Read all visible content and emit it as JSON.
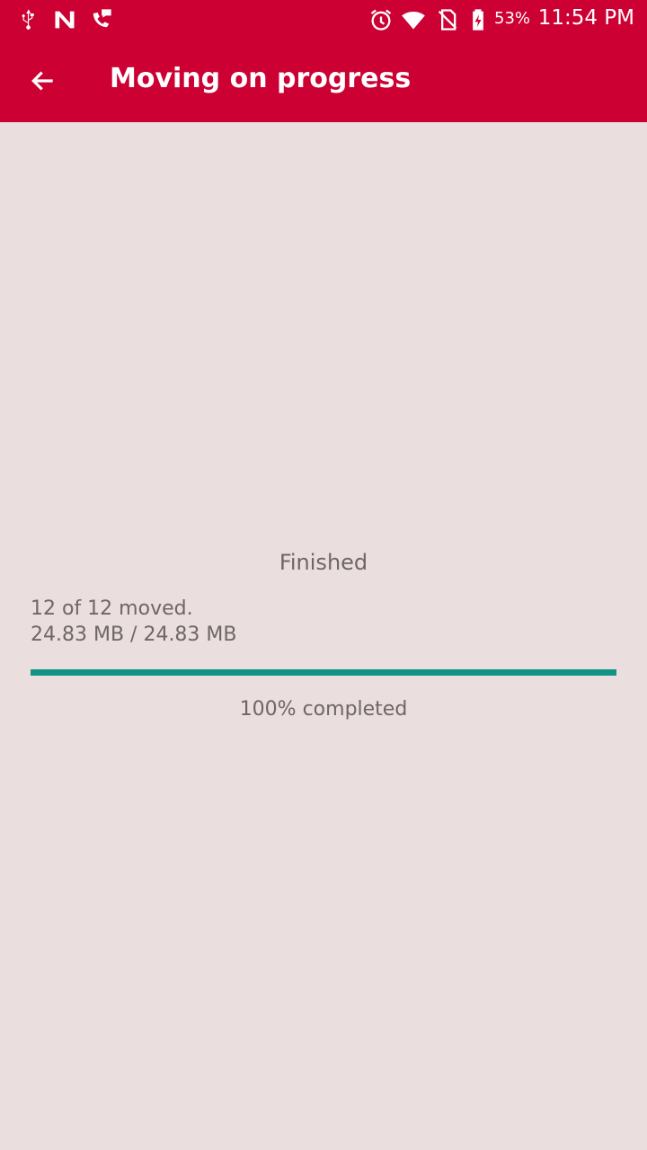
{
  "status_bar": {
    "icons": [
      "usb-icon",
      "n-app-icon",
      "call-message-icon",
      "alarm-icon",
      "wifi-icon",
      "no-sim-icon",
      "battery-charging-icon"
    ],
    "battery": "53%",
    "time": "11:54 PM"
  },
  "app_bar": {
    "title": "Moving on progress",
    "back_icon": "arrow-left-icon",
    "color": "#cc0033"
  },
  "progress": {
    "status": "Finished",
    "count": "12 of 12 moved.",
    "size": "24.83 MB / 24.83 MB",
    "fraction": 1.0,
    "percent_text": "100% completed",
    "bar_color": "#0f9486"
  },
  "background_color": "#eadede"
}
